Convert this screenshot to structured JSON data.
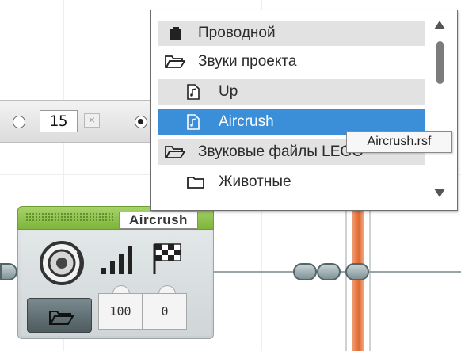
{
  "param_strip": {
    "number_value": "15",
    "clear_symbol": "×"
  },
  "dropdown": {
    "items": [
      {
        "label": "Проводной",
        "kind": "category",
        "icon": "brick-icon"
      },
      {
        "label": "Звуки проекта",
        "kind": "folder",
        "icon": "open-folder-icon"
      },
      {
        "label": "Up",
        "kind": "file",
        "icon": "sound-file-icon"
      },
      {
        "label": "Aircrush",
        "kind": "file-selected",
        "icon": "sound-file-icon"
      },
      {
        "label": "Звуковые файлы LEGO",
        "kind": "folder",
        "icon": "open-folder-icon"
      },
      {
        "label": "Животные",
        "kind": "subfolder",
        "icon": "folder-icon"
      }
    ],
    "tooltip": "Aircrush.rsf",
    "selected_color": "#3b8fd9"
  },
  "sound_block": {
    "file_name": "Aircrush",
    "volume": "100",
    "play_type": "0",
    "header_color": "#8cc04a"
  }
}
